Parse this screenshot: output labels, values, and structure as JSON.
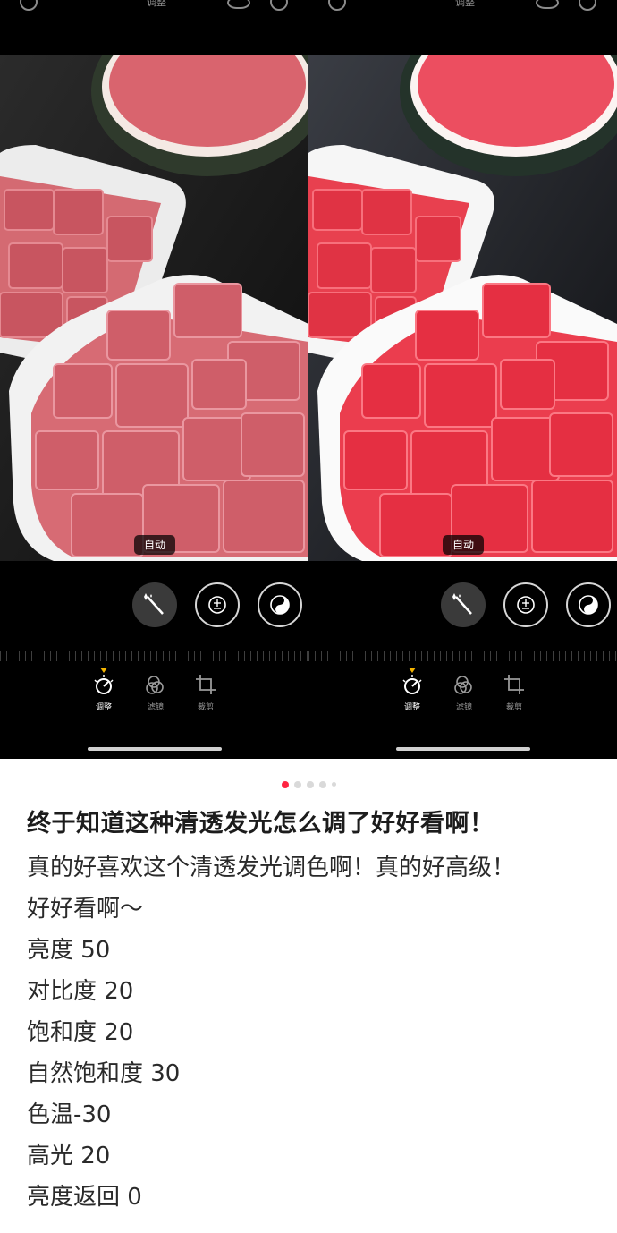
{
  "editor": {
    "toolbar_title": "调整",
    "auto_badge": "自动",
    "tabs": [
      {
        "label": "调整",
        "active": true
      },
      {
        "label": "滤镜",
        "active": false
      },
      {
        "label": "裁剪",
        "active": false
      }
    ],
    "tools": [
      "magic-wand",
      "exposure",
      "brilliance"
    ],
    "icons": [
      "undo-icon",
      "hide-icon",
      "auto-icon"
    ]
  },
  "pager": {
    "total": 5,
    "current": 1,
    "accent": "#ff2442"
  },
  "post": {
    "title": "终于知道这种清透发光怎么调了好好看啊！",
    "lines": [
      "真的好喜欢这个清透发光调色啊！真的好高级！",
      "好好看啊～",
      "亮度 50",
      "对比度 20",
      "饱和度 20",
      "自然饱和度 30",
      "色温-30",
      "高光 20",
      "亮度返回 0"
    ]
  }
}
